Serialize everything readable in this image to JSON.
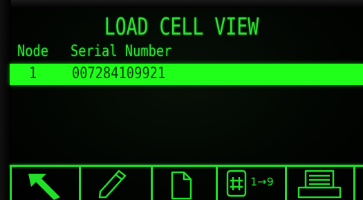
{
  "screen": {
    "title": "LOAD CELL VIEW"
  },
  "table": {
    "headers": {
      "node": "Node",
      "serial": "Serial Number"
    },
    "rows": [
      {
        "node": "1",
        "serial": "007284109921",
        "selected": true
      }
    ]
  },
  "softkeys": [
    {
      "icon": "exit-arrow-icon"
    },
    {
      "icon": "edit-pencil-icon"
    },
    {
      "icon": "new-document-icon"
    },
    {
      "icon": "sequence-numbering-icon",
      "label": "1→9"
    },
    {
      "icon": "printer-icon"
    },
    {
      "icon": "more-icon"
    }
  ],
  "colors": {
    "phosphor": "#22e02a",
    "highlight": "#1fff1a",
    "background": "#000000"
  }
}
